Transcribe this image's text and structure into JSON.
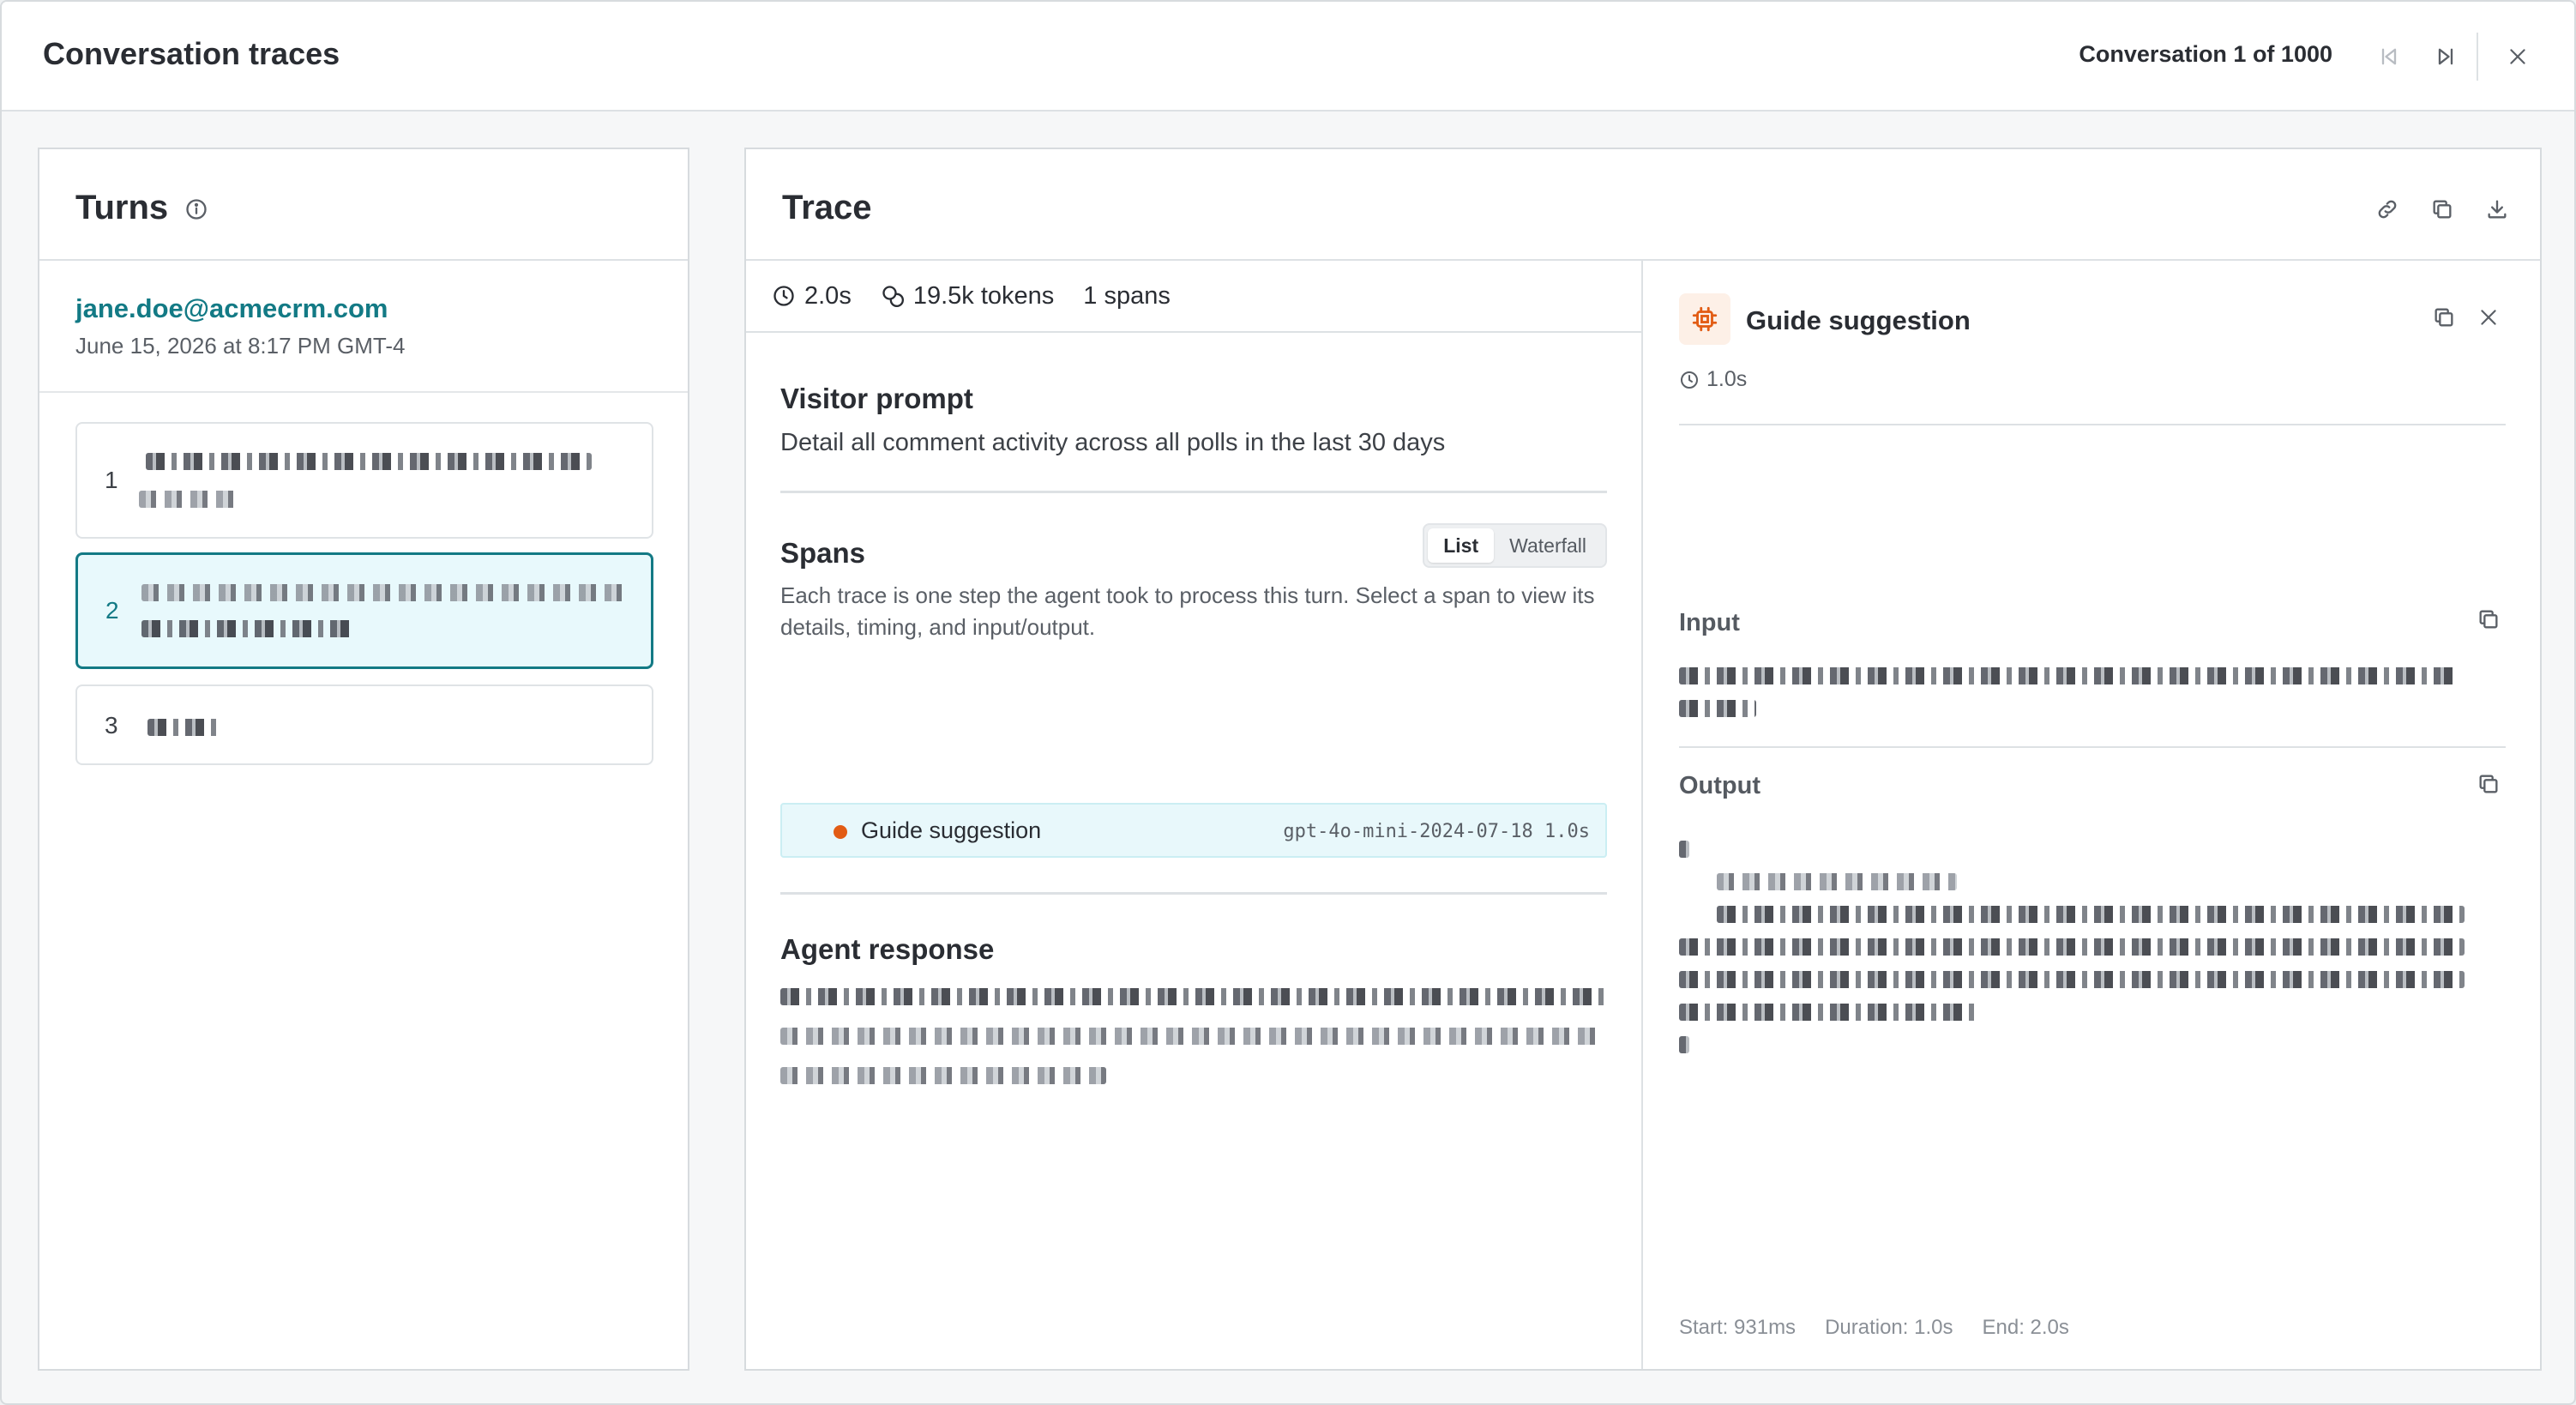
{
  "header": {
    "title": "Conversation traces",
    "counter": "Conversation 1 of 1000"
  },
  "turns": {
    "title": "Turns",
    "user_email": "jane.doe@acmecrm.com",
    "user_date": "June 15, 2026 at 8:17 PM GMT-4",
    "items": [
      {
        "number": "1",
        "active": false
      },
      {
        "number": "2",
        "active": true
      },
      {
        "number": "3",
        "active": false
      }
    ]
  },
  "trace": {
    "title": "Trace",
    "stats": {
      "duration": "2.0s",
      "tokens": "19.5k tokens",
      "spans": "1 spans"
    },
    "visitor_prompt": {
      "title": "Visitor prompt",
      "text": "Detail all comment activity across all polls in the last 30 days"
    },
    "spans": {
      "title": "Spans",
      "toggle": [
        "List",
        "Waterfall"
      ],
      "selected_toggle": "List",
      "description": "Each trace is one step the agent took to process this turn. Select a span to view its details, timing, and input/output.",
      "items": [
        {
          "name": "Guide suggestion",
          "model": "gpt-4o-mini-2024-07-18",
          "duration": "1.0s",
          "status_color": "#e25c14"
        }
      ]
    },
    "agent_response": {
      "title": "Agent response"
    }
  },
  "detail": {
    "title": "Guide suggestion",
    "duration": "1.0s",
    "input_label": "Input",
    "output_label": "Output",
    "footer": {
      "start": "Start: 931ms",
      "duration": "Duration: 1.0s",
      "end": "End: 2.0s"
    }
  },
  "colors": {
    "accent": "#137a85",
    "span_dot": "#e25c14",
    "active_bg": "#e8f9fc"
  }
}
